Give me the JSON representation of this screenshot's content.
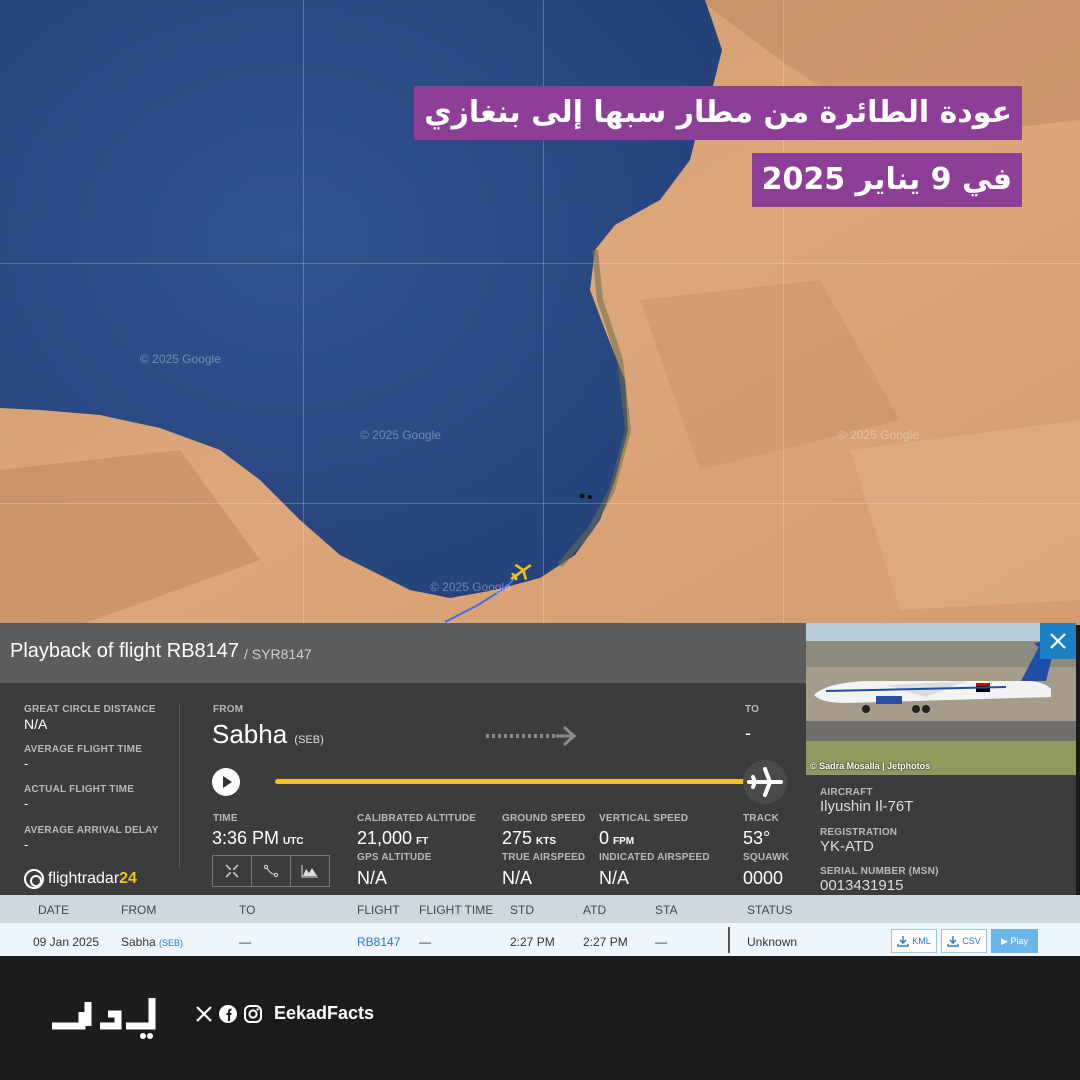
{
  "headline": {
    "line1": "عودة الطائرة من مطار سبها إلى بنغازي",
    "line2": "في 9 يناير 2025"
  },
  "map": {
    "watermark": "© 2025 Google"
  },
  "flight": {
    "title": "Playback of flight RB8147",
    "subtitle": "/ SYR8147",
    "great_circle_label": "GREAT CIRCLE DISTANCE",
    "great_circle_value": "N/A",
    "avg_flight_time_label": "AVERAGE FLIGHT TIME",
    "avg_flight_time_value": "-",
    "actual_flight_time_label": "ACTUAL FLIGHT TIME",
    "actual_flight_time_value": "-",
    "avg_arrival_delay_label": "AVERAGE ARRIVAL DELAY",
    "avg_arrival_delay_value": "-",
    "from_label": "FROM",
    "from_city": "Sabha",
    "from_code": "(SEB)",
    "to_label": "TO",
    "to_value": "-",
    "progress_fraction": 1.0,
    "time_label": "TIME",
    "time_value": "3:36 PM",
    "time_unit": "UTC",
    "cal_alt_label": "CALIBRATED ALTITUDE",
    "cal_alt_value": "21,000",
    "cal_alt_unit": "FT",
    "gps_alt_label": "GPS ALTITUDE",
    "gps_alt_value": "N/A",
    "ground_speed_label": "GROUND SPEED",
    "ground_speed_value": "275",
    "ground_speed_unit": "KTS",
    "true_airspeed_label": "TRUE AIRSPEED",
    "true_airspeed_value": "N/A",
    "vertical_speed_label": "VERTICAL SPEED",
    "vertical_speed_value": "0",
    "vertical_speed_unit": "FPM",
    "indicated_airspeed_label": "INDICATED AIRSPEED",
    "indicated_airspeed_value": "N/A",
    "track_label": "TRACK",
    "track_value": "53°",
    "squawk_label": "SQUAWK",
    "squawk_value": "0000",
    "logo_text": "flightradar",
    "logo_num": "24"
  },
  "aircraft": {
    "photo_credit": "© Sadra Mosalla | Jetphotos",
    "aircraft_label": "AIRCRAFT",
    "aircraft_value": "Ilyushin Il-76T",
    "registration_label": "REGISTRATION",
    "registration_value": "YK-ATD",
    "serial_label": "SERIAL NUMBER (MSN)",
    "serial_value": "0013431915"
  },
  "table": {
    "headers": [
      "DATE",
      "FROM",
      "TO",
      "FLIGHT",
      "FLIGHT TIME",
      "STD",
      "ATD",
      "STA",
      "STATUS"
    ],
    "row": {
      "date": "09 Jan 2025",
      "from_city": "Sabha",
      "from_code": "(SEB)",
      "to": "—",
      "flight": "RB8147",
      "flight_time": "—",
      "std": "2:27 PM",
      "atd": "2:27 PM",
      "sta": "—",
      "status": "Unknown",
      "kml": "KML",
      "csv": "CSV",
      "play": "▶ Play"
    }
  },
  "footer": {
    "handle": "EekadFacts"
  },
  "colors": {
    "headline_bg": "#8d3f98",
    "progress": "#f2c218",
    "sea": "#2e4a86",
    "accent_blue": "#1b80c4"
  }
}
